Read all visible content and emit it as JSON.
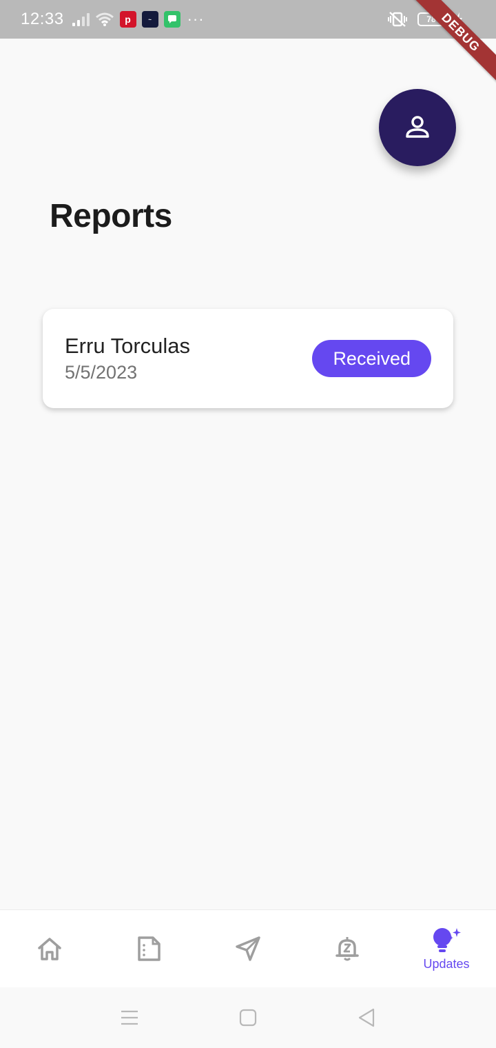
{
  "status_bar": {
    "time": "12:33",
    "more_indicator": "···",
    "battery_level": "78",
    "icons": [
      "signal-icon",
      "wifi-icon",
      "pinterest-icon",
      "app-notification-icon",
      "messages-icon",
      "vibrate-icon",
      "battery-icon",
      "charging-icon"
    ]
  },
  "debug_banner": "DEBUG",
  "header": {
    "title": "Reports",
    "profile_icon": "person-icon"
  },
  "reports": [
    {
      "name": "Erru Torculas",
      "date": "5/5/2023",
      "status": "Received"
    }
  ],
  "bottom_nav": {
    "items": [
      {
        "icon": "home-icon",
        "label": "",
        "active": false
      },
      {
        "icon": "document-icon",
        "label": "",
        "active": false
      },
      {
        "icon": "send-icon",
        "label": "",
        "active": false
      },
      {
        "icon": "snooze-bell-icon",
        "label": "",
        "active": false
      },
      {
        "icon": "lightbulb-icon",
        "label": "Updates",
        "active": true
      }
    ]
  },
  "system_nav": [
    "menu-icon",
    "home-square-icon",
    "back-icon"
  ],
  "colors": {
    "accent": "#6548f0",
    "fab": "#291c5f",
    "background": "#f9f9f9",
    "inactive_icon": "#9e9e9e"
  }
}
